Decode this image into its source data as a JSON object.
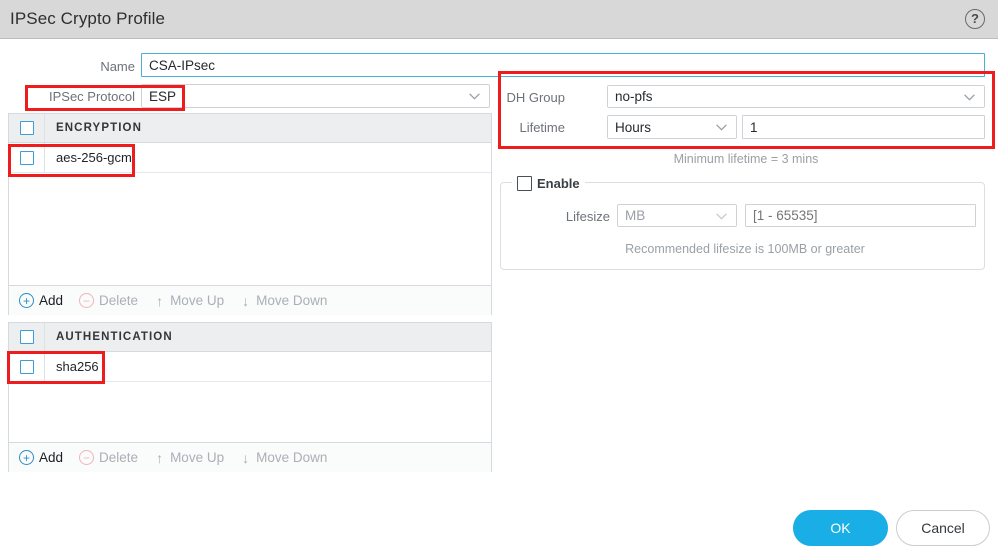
{
  "window": {
    "title": "IPSec Crypto Profile",
    "help_icon": "question-mark-icon"
  },
  "form": {
    "name": {
      "label": "Name",
      "value": "CSA-IPsec",
      "placeholder": ""
    },
    "ipsec_protocol": {
      "label": "IPSec Protocol",
      "value": "ESP"
    },
    "dh_group": {
      "label": "DH Group",
      "value": "no-pfs"
    },
    "lifetime": {
      "label": "Lifetime",
      "unit": "Hours",
      "value": "1",
      "hint": "Minimum lifetime = 3 mins"
    },
    "lifesize": {
      "enable_label": "Enable",
      "label": "Lifesize",
      "unit": "MB",
      "value": "",
      "placeholder": "[1 - 65535]",
      "hint": "Recommended lifesize is 100MB or greater"
    }
  },
  "encryption": {
    "header": "ENCRYPTION",
    "rows": [
      {
        "label": "aes-256-gcm"
      }
    ],
    "toolbar": {
      "add": "Add",
      "delete": "Delete",
      "move_up": "Move Up",
      "move_down": "Move Down"
    }
  },
  "authentication": {
    "header": "AUTHENTICATION",
    "rows": [
      {
        "label": "sha256"
      }
    ],
    "toolbar": {
      "add": "Add",
      "delete": "Delete",
      "move_up": "Move Up",
      "move_down": "Move Down"
    }
  },
  "footer": {
    "ok": "OK",
    "cancel": "Cancel"
  },
  "colors": {
    "accent": "#19aee5",
    "checkbox_border": "#3c9fd4",
    "annotation": "#ee1c1c",
    "titlebar": "#d8d8d8",
    "list_header": "#eceeef"
  }
}
